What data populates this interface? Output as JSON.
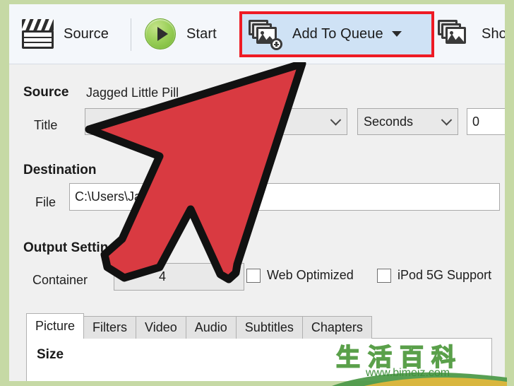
{
  "window": {
    "frame_color": "#c6d9a5",
    "background": "#f0f0f0"
  },
  "toolbar": {
    "background": "#f4f7fb",
    "items": [
      {
        "label": "Source",
        "icon": "clapperboard-icon"
      },
      {
        "label": "Start",
        "icon": "play-circle-icon"
      },
      {
        "label": "Add To Queue",
        "icon": "add-to-queue-icon",
        "has_dropdown": true,
        "highlighted": true
      },
      {
        "label": "Show",
        "icon": "show-queue-icon"
      }
    ],
    "highlight_color": "#ee1b24",
    "highlight_fill": "#cfe2f5"
  },
  "source": {
    "heading": "Source",
    "name": "Jagged Little Pill",
    "title_label": "Title",
    "title_value": "",
    "units_value": "Seconds",
    "start_value": "0"
  },
  "destination": {
    "heading": "Destination",
    "file_label": "File",
    "file_value": "C:\\Users\\Jan                          mp4"
  },
  "output_settings": {
    "heading": "Output Settings",
    "container_label": "Container",
    "container_value": "4",
    "web_optimized_label": "Web Optimized",
    "web_optimized_checked": false,
    "ipod_label": "iPod 5G Support",
    "ipod_checked": false
  },
  "tabs": {
    "items": [
      {
        "label": "Picture",
        "active": true
      },
      {
        "label": "Filters",
        "active": false
      },
      {
        "label": "Video",
        "active": false
      },
      {
        "label": "Audio",
        "active": false
      },
      {
        "label": "Subtitles",
        "active": false
      },
      {
        "label": "Chapters",
        "active": false
      }
    ],
    "panel_heading": "Size"
  },
  "cursor": {
    "type": "arrow-pointer",
    "fill": "#d93a41",
    "outline": "#111111",
    "points_to": "Add To Queue"
  },
  "watermark": {
    "characters": "生活百科",
    "url": "www.bimeiz.com"
  }
}
